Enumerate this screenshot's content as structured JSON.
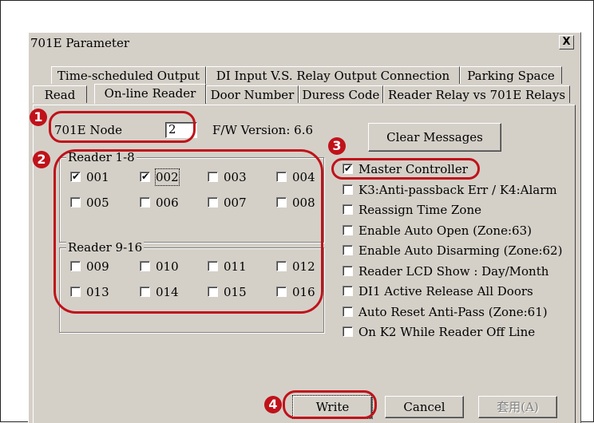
{
  "window": {
    "title": "701E Parameter",
    "close_label": "X"
  },
  "tabs_row1": [
    {
      "label": "Time-scheduled Output"
    },
    {
      "label": "DI Input  V.S. Relay Output Connection"
    },
    {
      "label": "Parking Space"
    }
  ],
  "tabs_row2": [
    {
      "label": "Read"
    },
    {
      "label": "On-line Reader",
      "active": true
    },
    {
      "label": "Door Number"
    },
    {
      "label": "Duress Code"
    },
    {
      "label": "Reader Relay vs 701E Relays"
    }
  ],
  "node": {
    "label": "701E Node",
    "value": "2",
    "fw_label": "F/W Version: 6.6"
  },
  "clear_button": "Clear Messages",
  "reader_group_1": {
    "title": "Reader 1-8",
    "items": [
      {
        "label": "001",
        "checked": true
      },
      {
        "label": "002",
        "checked": true
      },
      {
        "label": "003",
        "checked": false
      },
      {
        "label": "004",
        "checked": false
      },
      {
        "label": "005",
        "checked": false
      },
      {
        "label": "006",
        "checked": false
      },
      {
        "label": "007",
        "checked": false
      },
      {
        "label": "008",
        "checked": false
      }
    ]
  },
  "reader_group_2": {
    "title": "Reader 9-16",
    "items": [
      {
        "label": "009",
        "checked": false
      },
      {
        "label": "010",
        "checked": false
      },
      {
        "label": "011",
        "checked": false
      },
      {
        "label": "012",
        "checked": false
      },
      {
        "label": "013",
        "checked": false
      },
      {
        "label": "014",
        "checked": false
      },
      {
        "label": "015",
        "checked": false
      },
      {
        "label": "016",
        "checked": false
      }
    ]
  },
  "options": [
    {
      "label": "Master Controller",
      "checked": true
    },
    {
      "label": "K3:Anti-passback Err / K4:Alarm",
      "checked": false
    },
    {
      "label": "Reassign Time Zone",
      "checked": false
    },
    {
      "label": "Enable Auto Open  (Zone:63)",
      "checked": false
    },
    {
      "label": "Enable Auto Disarming (Zone:62)",
      "checked": false
    },
    {
      "label": "Reader LCD Show : Day/Month",
      "checked": false
    },
    {
      "label": "DI1 Active Release All Doors",
      "checked": false
    },
    {
      "label": "Auto Reset Anti-Pass (Zone:61)",
      "checked": false
    },
    {
      "label": "On K2 While Reader Off Line",
      "checked": false
    }
  ],
  "footer": {
    "write": "Write",
    "cancel": "Cancel",
    "apply": "套用(A)"
  },
  "annotations": [
    "1",
    "2",
    "3",
    "4"
  ],
  "colors": {
    "annotation": "#c0121a",
    "dialog_bg": "#d4d0c8"
  },
  "icons": {
    "check": "checkmark-icon",
    "close": "close-icon"
  }
}
